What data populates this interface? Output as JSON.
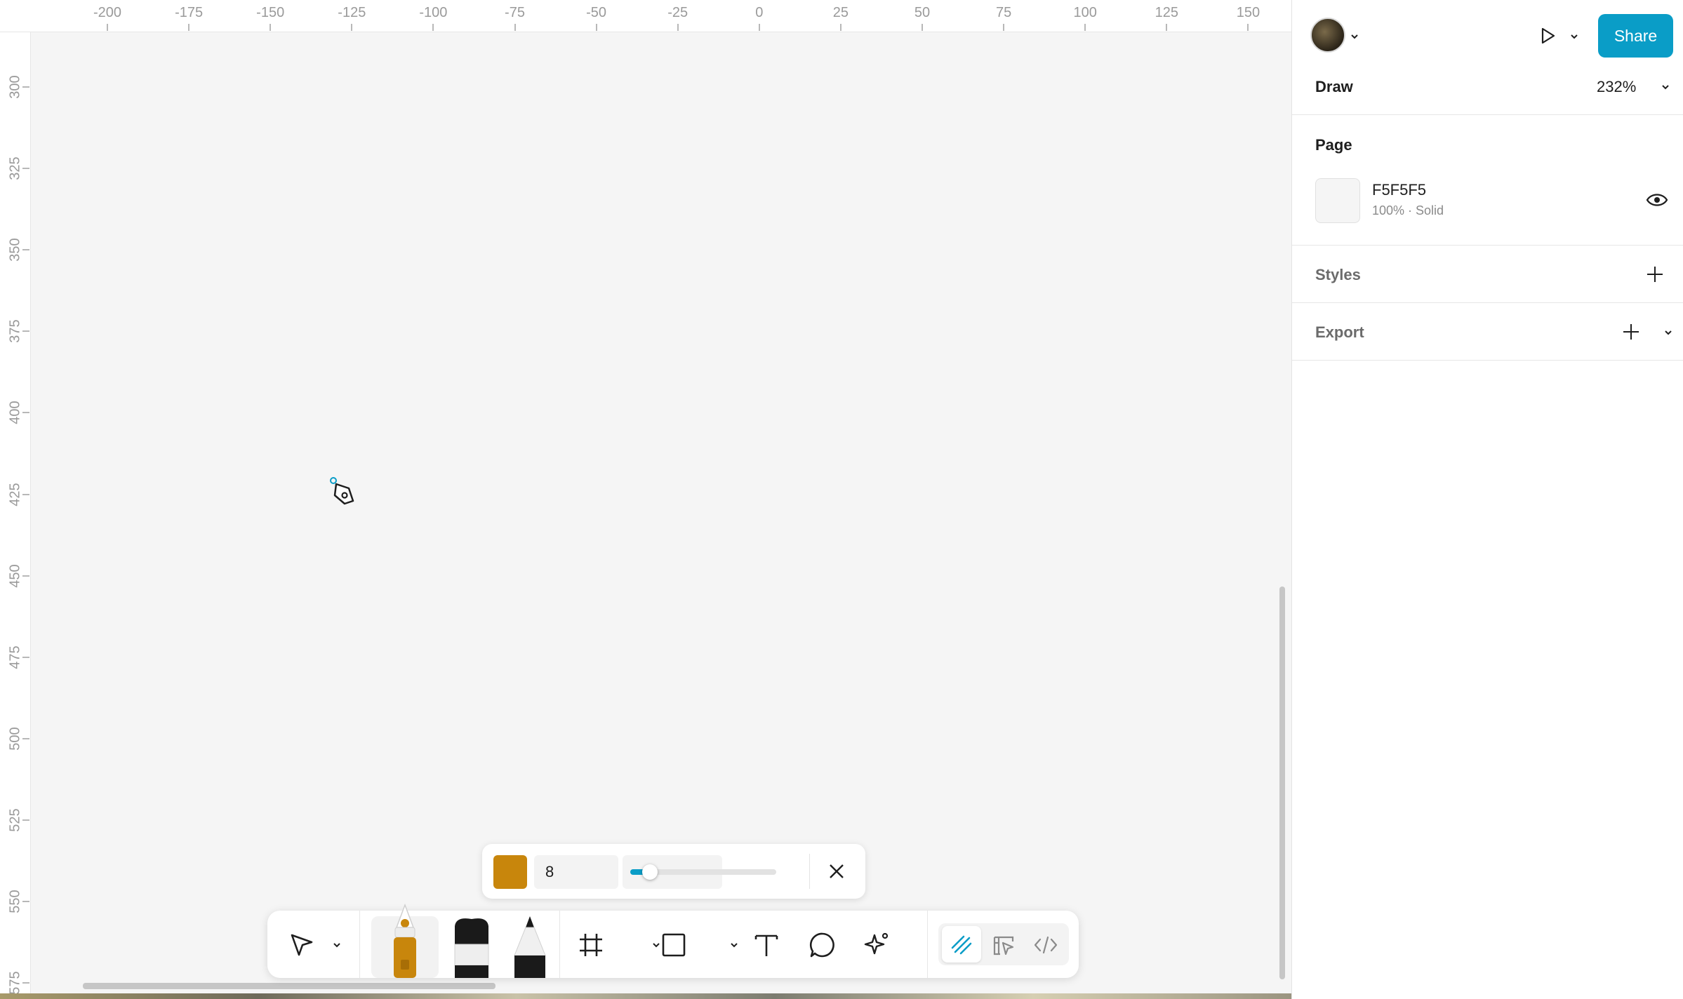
{
  "ruler": {
    "top_labels": [
      "-200",
      "-175",
      "-150",
      "-125",
      "-100",
      "-75",
      "-50",
      "-25",
      "0",
      "25",
      "50",
      "75",
      "100",
      "125",
      "150"
    ],
    "left_labels": [
      "300",
      "325",
      "350",
      "375",
      "400",
      "425",
      "450",
      "475",
      "500",
      "525",
      "550",
      "575"
    ]
  },
  "header": {
    "avatar_icon": "user-avatar",
    "play_icon": "play-icon",
    "share_label": "Share"
  },
  "draw": {
    "title": "Draw",
    "zoom": "232%"
  },
  "page": {
    "title": "Page",
    "fill_hex": "F5F5F5",
    "fill_meta": "100% · Solid",
    "fill_color": "#F5F5F5"
  },
  "styles": {
    "title": "Styles"
  },
  "export": {
    "title": "Export"
  },
  "brush": {
    "color": "#C8860C",
    "size": "8",
    "size_level": 0.1
  },
  "toolbar": {
    "items": [
      "move-tool",
      "pen-tool",
      "brush-tool",
      "pencil-tool",
      "frame-tool",
      "rectangle-tool",
      "text-tool",
      "comment-tool",
      "ai-tool",
      "draw-mode",
      "design-mode",
      "dev-mode"
    ]
  },
  "colors": {
    "accent": "#0A9DC7",
    "canvas": "#F5F5F5"
  }
}
